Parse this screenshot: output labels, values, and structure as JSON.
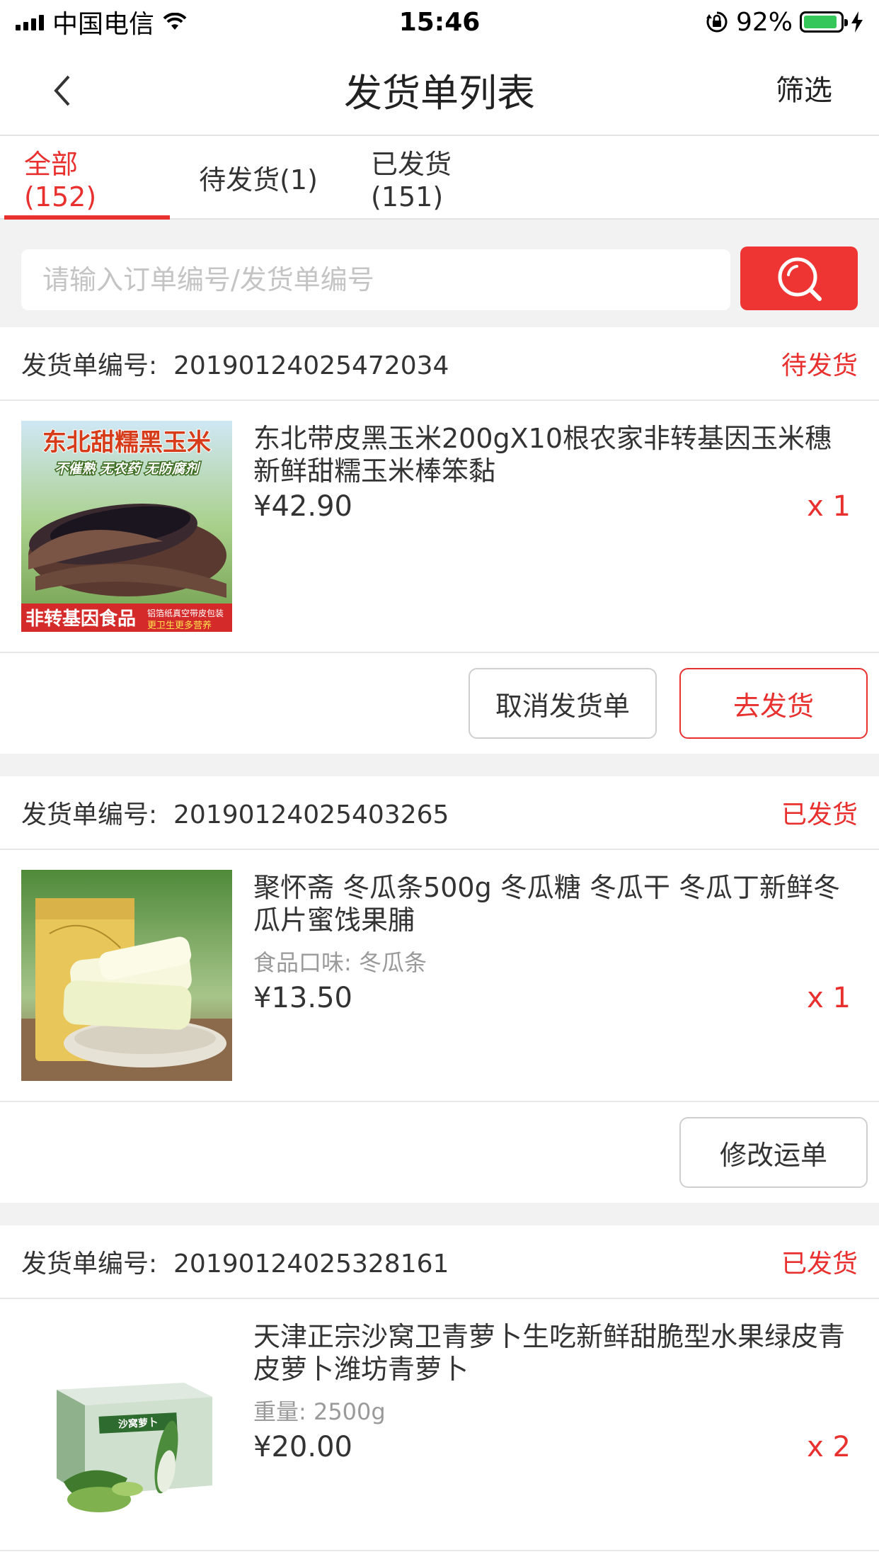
{
  "status_bar": {
    "carrier": "中国电信",
    "time": "15:46",
    "battery": "92%",
    "battery_level": 0.92
  },
  "nav": {
    "title": "发货单列表",
    "filter_label": "筛选"
  },
  "tabs": [
    {
      "label": "全部(152)",
      "active": true
    },
    {
      "label": "待发货(1)",
      "active": false
    },
    {
      "label": "已发货(151)",
      "active": false
    }
  ],
  "search": {
    "placeholder": "请输入订单编号/发货单编号"
  },
  "orders": [
    {
      "no_label": "发货单编号:",
      "no": "20190124025472034",
      "status": "待发货",
      "product": {
        "title": "东北带皮黑玉米200gX10根农家非转基因玉米穗新鲜甜糯玉米棒笨黏",
        "spec": "",
        "price": "¥42.90",
        "qty": "x 1",
        "image": {
          "headline": "东北甜糯黑玉米",
          "tagline": "不催熟 无农药 无防腐剂",
          "badge": "非转基因食品",
          "note1": "铝箔纸真空带皮包装",
          "note2": "更卫生更多营养"
        }
      },
      "actions": [
        "取消发货单",
        "去发货"
      ]
    },
    {
      "no_label": "发货单编号:",
      "no": "20190124025403265",
      "status": "已发货",
      "product": {
        "title": "聚怀斋 冬瓜条500g 冬瓜糖 冬瓜干 冬瓜丁新鲜冬瓜片蜜饯果脯",
        "spec": "食品口味: 冬瓜条",
        "price": "¥13.50",
        "qty": "x 1"
      },
      "actions": [
        "修改运单"
      ]
    },
    {
      "no_label": "发货单编号:",
      "no": "20190124025328161",
      "status": "已发货",
      "product": {
        "title": "天津正宗沙窝卫青萝卜生吃新鲜甜脆型水果绿皮青皮萝卜潍坊青萝卜",
        "spec": "重量: 2500g",
        "price": "¥20.00",
        "qty": "x 2",
        "image": {
          "box_label": "沙窝萝卜"
        }
      },
      "actions": []
    }
  ],
  "colors": {
    "accent": "#e8302f",
    "search_button": "#ef3434",
    "background": "#f2f2f2"
  }
}
